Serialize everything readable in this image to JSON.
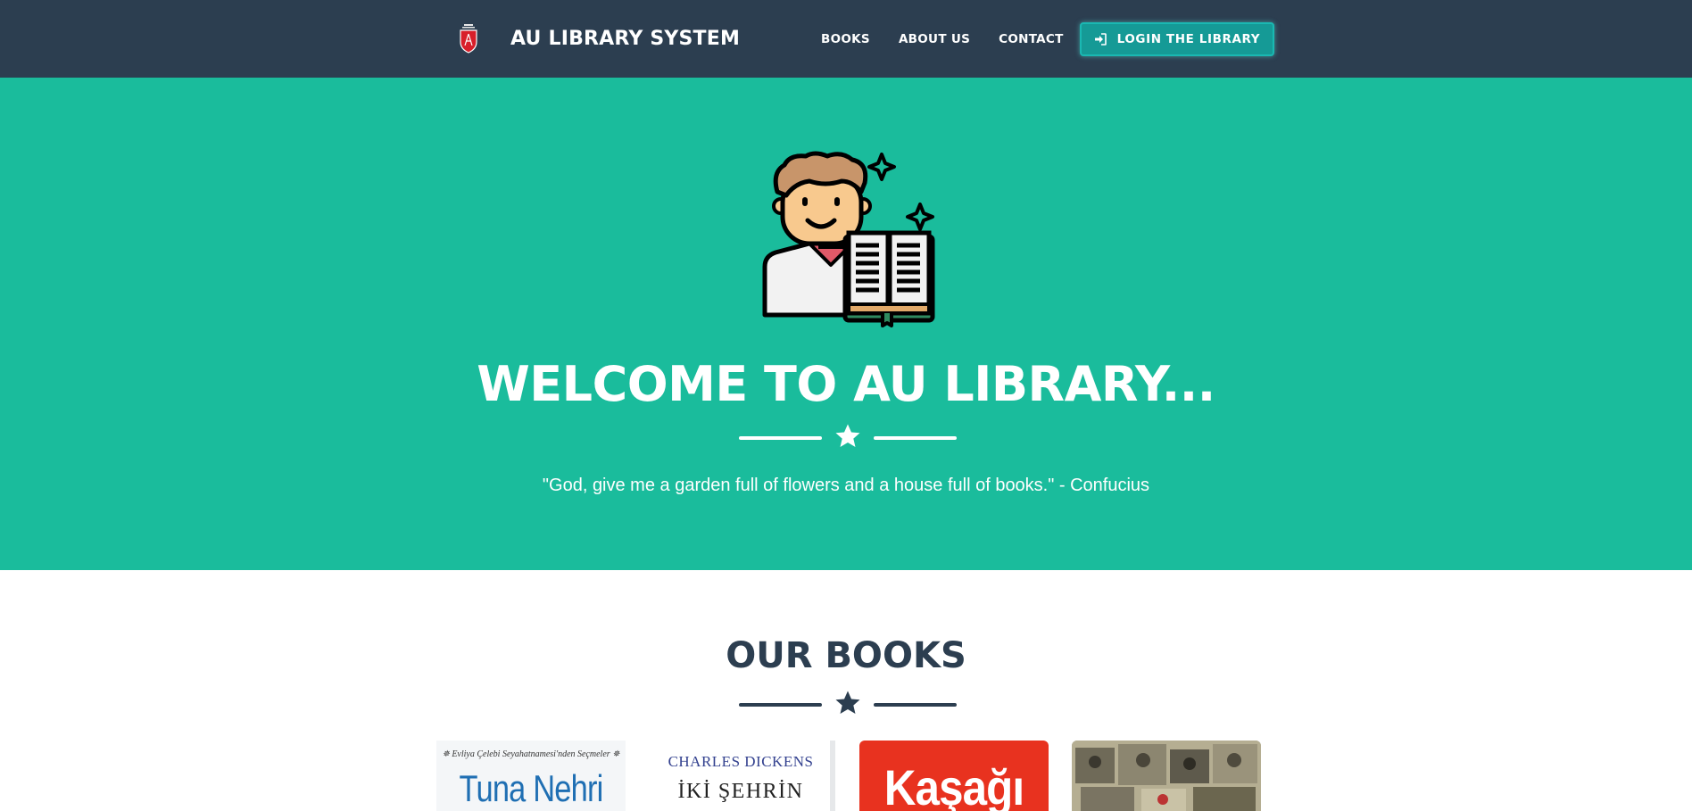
{
  "navbar": {
    "brand": "AU LIBRARY SYSTEM",
    "links": [
      "BOOKS",
      "ABOUT US",
      "CONTACT"
    ],
    "login_label": "LOGIN THE LIBRARY"
  },
  "hero": {
    "title": "WELCOME TO AU LIBRARY...",
    "quote": "\"God, give me a garden full of flowers and a house full of books.\" - Confucius"
  },
  "books_section": {
    "title": "OUR BOOKS",
    "books": [
      {
        "top_text": "✵ Evliya Çelebi Seyahatnamesi'nden Seçmeler ✵",
        "title": "Tuna Nehri"
      },
      {
        "author": "CHARLES DICKENS",
        "title": "İKİ ŞEHRİN"
      },
      {
        "title": "Kaşağı"
      },
      {
        "title": ""
      }
    ]
  },
  "colors": {
    "navbar": "#2c3e50",
    "hero": "#1abc9c",
    "login_button": "#159a96",
    "heading_dark": "#2c3e50"
  },
  "icons": {
    "logo": "university-shield-logo",
    "login": "sign-in-icon",
    "hero": "reader-avatar-illustration",
    "divider": "star-icon"
  }
}
